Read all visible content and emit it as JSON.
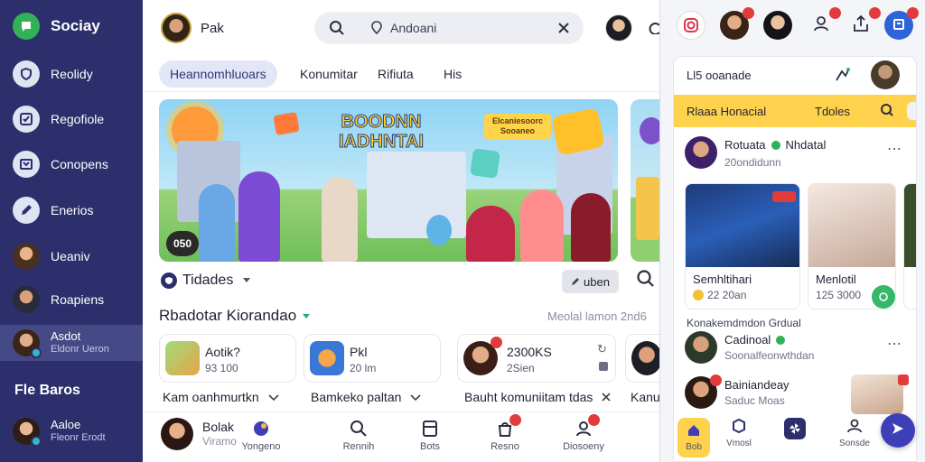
{
  "app": {
    "name": "Sociay"
  },
  "colors": {
    "sidebar": "#2c2f6b",
    "accent": "#3e3fb8",
    "brand_green": "#31b257",
    "highlight": "#ffd24d",
    "badge_red": "#e23b3b"
  },
  "sidebar": {
    "items": [
      {
        "label": "Reolidy",
        "icon": "shield-icon"
      },
      {
        "label": "Regofiole",
        "icon": "check-square-icon"
      },
      {
        "label": "Conopens",
        "icon": "box-icon"
      },
      {
        "label": "Enerios",
        "icon": "pen-icon"
      },
      {
        "label": "Ueaniv",
        "icon": "avatar"
      },
      {
        "label": "Roapiens",
        "icon": "avatar"
      },
      {
        "label": "Asdot",
        "sub": "Eldonr Ueron",
        "icon": "avatar"
      }
    ],
    "section_title": "Fle Baros",
    "footer_user": {
      "name": "Aaloe",
      "sub": "Fleonr Erodt"
    }
  },
  "topbar": {
    "user_name": "Pak",
    "search_value": "Andoani"
  },
  "tabs": [
    {
      "label": "Heannomhluoars",
      "active": true
    },
    {
      "label": "Konumitar",
      "active": false
    },
    {
      "label": "Rifiuta",
      "active": false
    },
    {
      "label": "His",
      "active": false
    }
  ],
  "hero": {
    "title": "BOODNN IADHNTAI",
    "subtitle": "Elcaniesoorc Sooaneo",
    "counter": "050"
  },
  "section": {
    "label": "Tidades",
    "button": "uben"
  },
  "recommend": {
    "title": "Rbadotar Kiorandao",
    "meta": "Meolal lamon 2nd6"
  },
  "cards": [
    {
      "title": "Aotik?",
      "sub": "93 100"
    },
    {
      "title": "Pkl",
      "sub": "20 lm"
    },
    {
      "title": "2300KS",
      "sub": "2Sien",
      "badge": ""
    },
    {
      "title": "",
      "sub": ""
    }
  ],
  "captions": [
    "Kam oanhmurtkn",
    "Bamkeko paltan",
    "Bauht komuniitam tdas",
    "Kanu"
  ],
  "bottom_nav": {
    "profile": {
      "name": "Bolak",
      "sub": "Viramo"
    },
    "items": [
      {
        "label": "Yongeno",
        "icon": "app-icon"
      },
      {
        "label": "Rennih",
        "icon": "search-icon"
      },
      {
        "label": "Bots",
        "icon": "inbox-icon"
      },
      {
        "label": "Resno",
        "icon": "bag-icon",
        "badge": ""
      },
      {
        "label": "Diosoeny",
        "icon": "user-icon",
        "badge": ""
      }
    ]
  },
  "panel": {
    "top_badges": [
      "",
      "",
      "",
      ""
    ],
    "search_hint": "Ll5 ooanade",
    "yellow_left": "Rlaaa Honacial",
    "yellow_right": "Tdoles",
    "post_author": "Rotuata",
    "post_author2": "Nhdatal",
    "post_time": "20ondidunn",
    "photos": [
      {
        "title": "Semhltihari",
        "sub": "22 20an",
        "tag": ""
      },
      {
        "title": "Menlotil",
        "sub": "125 3000"
      }
    ],
    "group_heading": "Konakemdmdon Grdual",
    "group_name": "Cadinoal",
    "group_sub": "Soonalfeonwthdan",
    "bottom_name": "Bainiandeay",
    "bottom_sub": "Saduc Moas",
    "nav": [
      {
        "label": "Bob",
        "icon": "home-icon"
      },
      {
        "label": "Vmosl",
        "icon": "box-icon"
      },
      {
        "label": "",
        "icon": "pinwheel-icon"
      },
      {
        "label": "Sonsde",
        "icon": "person-icon"
      }
    ]
  }
}
